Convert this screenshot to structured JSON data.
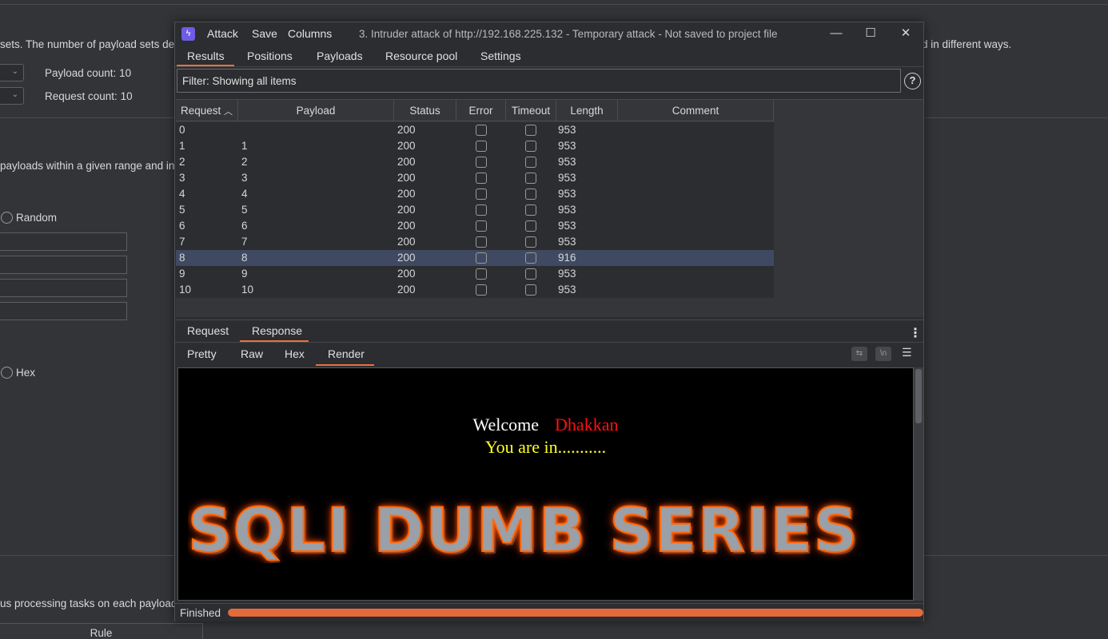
{
  "background": {
    "description_text": "sets. The number of payload sets de",
    "description_text_right": "d in different ways.",
    "payload_count_label": "Payload count:",
    "payload_count": "10",
    "request_count_label": "Request count:",
    "request_count": "10",
    "range_text": "payloads within a given range and in",
    "random_label": "Random",
    "hex_label": "Hex",
    "processing_text": "us processing tasks on each payload",
    "rule_header": "Rule"
  },
  "window": {
    "menu": [
      "Attack",
      "Save",
      "Columns"
    ],
    "title": "3. Intruder attack of http://192.168.225.132 - Temporary attack - Not saved to project file",
    "controls": {
      "minimize": "—",
      "maximize": "☐",
      "close": "✕"
    }
  },
  "tabs": [
    "Results",
    "Positions",
    "Payloads",
    "Resource pool",
    "Settings"
  ],
  "active_tab": "Results",
  "filter": "Filter: Showing all items",
  "table": {
    "columns": [
      "Request",
      "Payload",
      "Status",
      "Error",
      "Timeout",
      "Length",
      "Comment"
    ],
    "sort_indicator": "^",
    "rows": [
      {
        "request": "0",
        "payload": "",
        "status": "200",
        "length": "953"
      },
      {
        "request": "1",
        "payload": "1",
        "status": "200",
        "length": "953"
      },
      {
        "request": "2",
        "payload": "2",
        "status": "200",
        "length": "953"
      },
      {
        "request": "3",
        "payload": "3",
        "status": "200",
        "length": "953"
      },
      {
        "request": "4",
        "payload": "4",
        "status": "200",
        "length": "953"
      },
      {
        "request": "5",
        "payload": "5",
        "status": "200",
        "length": "953"
      },
      {
        "request": "6",
        "payload": "6",
        "status": "200",
        "length": "953"
      },
      {
        "request": "7",
        "payload": "7",
        "status": "200",
        "length": "953"
      },
      {
        "request": "8",
        "payload": "8",
        "status": "200",
        "length": "916"
      },
      {
        "request": "9",
        "payload": "9",
        "status": "200",
        "length": "953"
      },
      {
        "request": "10",
        "payload": "10",
        "status": "200",
        "length": "953"
      }
    ],
    "selected_row": 8
  },
  "message_tabs": [
    "Request",
    "Response"
  ],
  "active_message_tab": "Response",
  "view_tabs": [
    "Pretty",
    "Raw",
    "Hex",
    "Render"
  ],
  "active_view_tab": "Render",
  "tool_icons": {
    "wrap": "⇆",
    "newline": "\\n",
    "menu": "☰"
  },
  "render": {
    "welcome": "Welcome",
    "name": "Dhakkan",
    "message": "You are in...........",
    "banner": "SQLI DUMB SERIES"
  },
  "status": {
    "text": "Finished",
    "progress": 1.0
  },
  "colors": {
    "accent": "#e8703f",
    "selected_row": "#3f4a62",
    "progress": "#e26a3b"
  }
}
